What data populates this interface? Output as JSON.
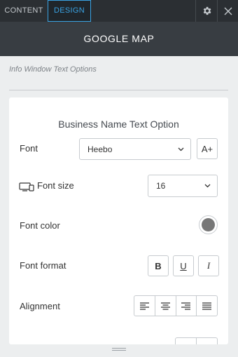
{
  "topbar": {
    "tab_content": "CONTENT",
    "tab_design": "DESIGN",
    "settings_icon": "gear-icon",
    "close_icon": "close-icon"
  },
  "header": {
    "title": "GOOGLE MAP"
  },
  "section": {
    "label": "Info Window Text Options"
  },
  "card": {
    "title": "Business Name Text Option",
    "font": {
      "label": "Font",
      "value": "Heebo",
      "add_icon": "add-font-icon",
      "add_label": "A+"
    },
    "font_size": {
      "label": "Font size",
      "value": "16",
      "icon": "desktop-mobile-icon"
    },
    "font_color": {
      "label": "Font color",
      "color": "#777777"
    },
    "font_format": {
      "label": "Font format",
      "bold": "B",
      "underline": "U",
      "italic": "I"
    },
    "alignment": {
      "label": "Alignment",
      "options": [
        "align-left",
        "align-center",
        "align-right",
        "align-justify"
      ]
    }
  },
  "colors": {
    "accent": "#3aa3e3",
    "topbar": "#2b2f33",
    "header": "#383d42"
  }
}
